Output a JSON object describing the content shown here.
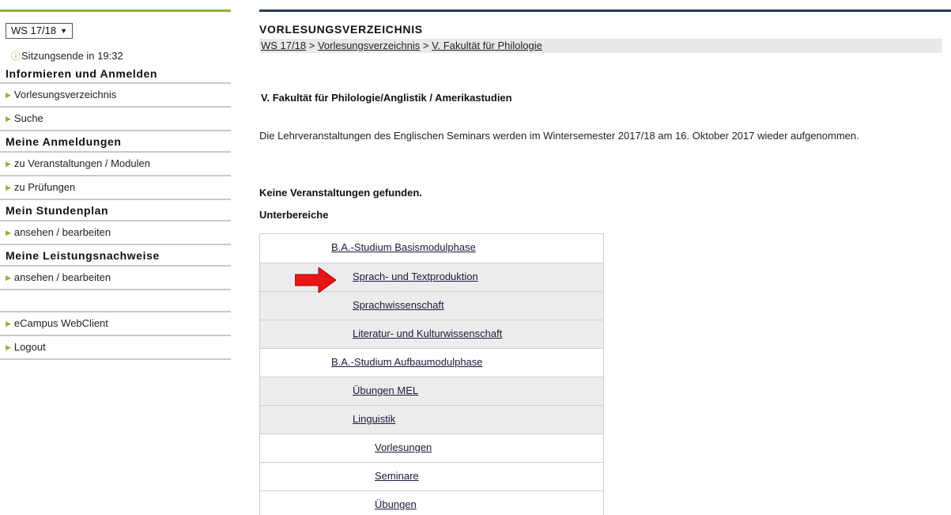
{
  "sidebar": {
    "semester": "WS 17/18",
    "semester_arrow": "▼",
    "session_icon": "info-icon",
    "session_glyph": "ⓘ",
    "session_text": "Sitzungsende in 19:32",
    "sections": [
      {
        "title": "Informieren und Anmelden",
        "items": [
          "Vorlesungsverzeichnis",
          "Suche"
        ]
      },
      {
        "title": "Meine Anmeldungen",
        "items": [
          "zu Veranstaltungen / Modulen",
          "zu Prüfungen"
        ]
      },
      {
        "title": "Mein Stundenplan",
        "items": [
          "ansehen / bearbeiten"
        ]
      },
      {
        "title": "Meine Leistungsnachweise",
        "items": [
          "ansehen / bearbeiten"
        ]
      }
    ],
    "extra_items": [
      "eCampus WebClient",
      "Logout"
    ],
    "bullet": "▶"
  },
  "main": {
    "title": "VORLESUNGSVERZEICHNIS",
    "breadcrumb": {
      "items": [
        "WS 17/18",
        "Vorlesungsverzeichnis",
        "V. Fakultät für Philologie"
      ],
      "separator": ">"
    },
    "faculty_heading": "V. Fakultät für Philologie/Anglistik / Amerikastudien",
    "notice": "Die Lehrveranstaltungen des Englischen Seminars werden im Wintersemester 2017/18 am 16. Oktober 2017 wieder aufgenommen.",
    "no_courses": "Keine Veranstaltungen gefunden.",
    "subareas_heading": "Unterbereiche",
    "subareas": [
      {
        "label": "B.A.-Studium Basismodulphase",
        "level": 1
      },
      {
        "label": "Sprach- und Textproduktion",
        "level": 2
      },
      {
        "label": "Sprachwissenschaft",
        "level": 2
      },
      {
        "label": "Literatur- und Kulturwissenschaft",
        "level": 2
      },
      {
        "label": "B.A.-Studium Aufbaumodulphase",
        "level": 1
      },
      {
        "label": "Übungen MEL",
        "level": 2
      },
      {
        "label": "Linguistik",
        "level": 2
      },
      {
        "label": "Vorlesungen",
        "level": 3
      },
      {
        "label": "Seminare",
        "level": 3
      },
      {
        "label": "Übungen",
        "level": 3
      }
    ]
  },
  "colors": {
    "sidebar_accent": "#8db22e",
    "main_accent": "#2a3a55",
    "arrow": "#e8141a"
  }
}
